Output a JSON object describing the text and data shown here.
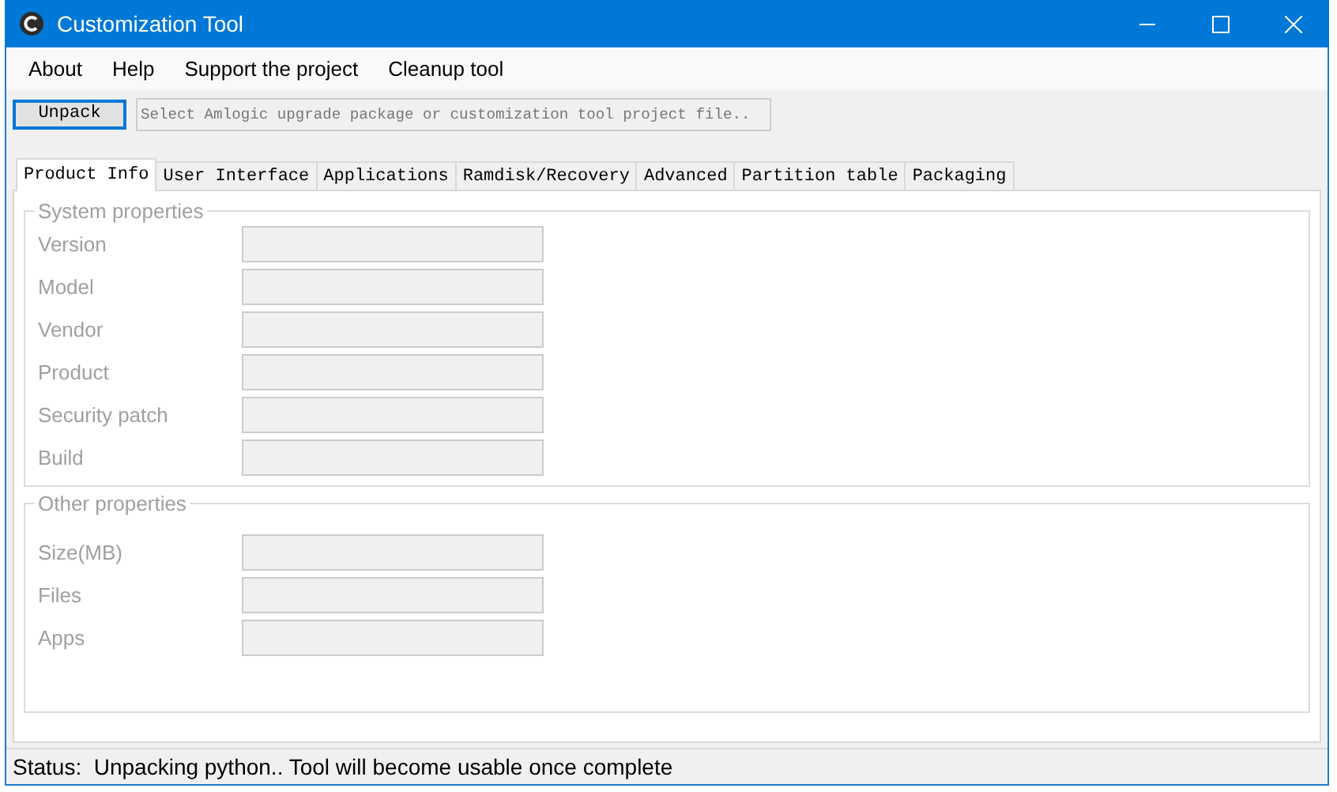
{
  "window": {
    "title": "Customization Tool"
  },
  "menu": [
    "About",
    "Help",
    "Support the project",
    "Cleanup tool"
  ],
  "toolbar": {
    "button": "Unpack",
    "path": {
      "placeholder": "Select Amlogic upgrade package or customization tool project file.."
    }
  },
  "tabs": [
    {
      "label": "Product Info",
      "selected": true
    },
    {
      "label": "User Interface",
      "selected": false
    },
    {
      "label": "Applications",
      "selected": false
    },
    {
      "label": "Ramdisk/Recovery",
      "selected": false
    },
    {
      "label": "Advanced",
      "selected": false
    },
    {
      "label": "Partition table",
      "selected": false
    },
    {
      "label": "Packaging",
      "selected": false
    }
  ],
  "groups": [
    {
      "title": "System properties",
      "fields": [
        {
          "label": "Version",
          "disabled": true
        },
        {
          "label": "Model",
          "disabled": true
        },
        {
          "label": "Vendor",
          "disabled": true
        },
        {
          "label": "Product",
          "disabled": true
        },
        {
          "label": "Security patch",
          "disabled": true
        },
        {
          "label": "Build",
          "disabled": true
        }
      ]
    },
    {
      "title": "Other properties",
      "fields": [
        {
          "label": "Size(MB)",
          "disabled": true
        },
        {
          "label": "Files",
          "disabled": true
        },
        {
          "label": "Apps",
          "disabled": true
        }
      ]
    }
  ],
  "status_bar": "Status:  Unpacking python.. Tool will become usable once complete"
}
